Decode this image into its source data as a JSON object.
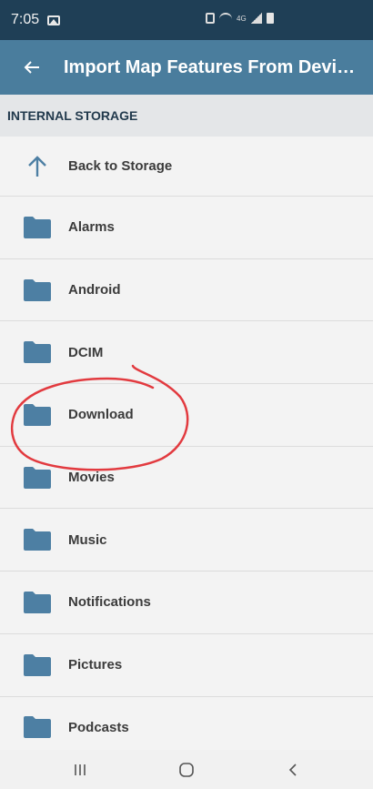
{
  "status_bar": {
    "time": "7:05",
    "lte_label": "4G"
  },
  "app_bar": {
    "title": "Import Map Features From Device..."
  },
  "section": {
    "title": "INTERNAL STORAGE"
  },
  "back_row": {
    "label": "Back to Storage"
  },
  "folders": [
    {
      "label": "Alarms"
    },
    {
      "label": "Android"
    },
    {
      "label": "DCIM"
    },
    {
      "label": "Download"
    },
    {
      "label": "Movies"
    },
    {
      "label": "Music"
    },
    {
      "label": "Notifications"
    },
    {
      "label": "Pictures"
    },
    {
      "label": "Podcasts"
    }
  ],
  "colors": {
    "status_bar": "#1f3f56",
    "app_bar": "#4a7d9d",
    "folder_icon": "#4d7fa3",
    "annotation": "#e23a3f"
  },
  "icons": {
    "back": "arrow-left-icon",
    "up": "arrow-up-icon",
    "folder": "folder-icon"
  }
}
